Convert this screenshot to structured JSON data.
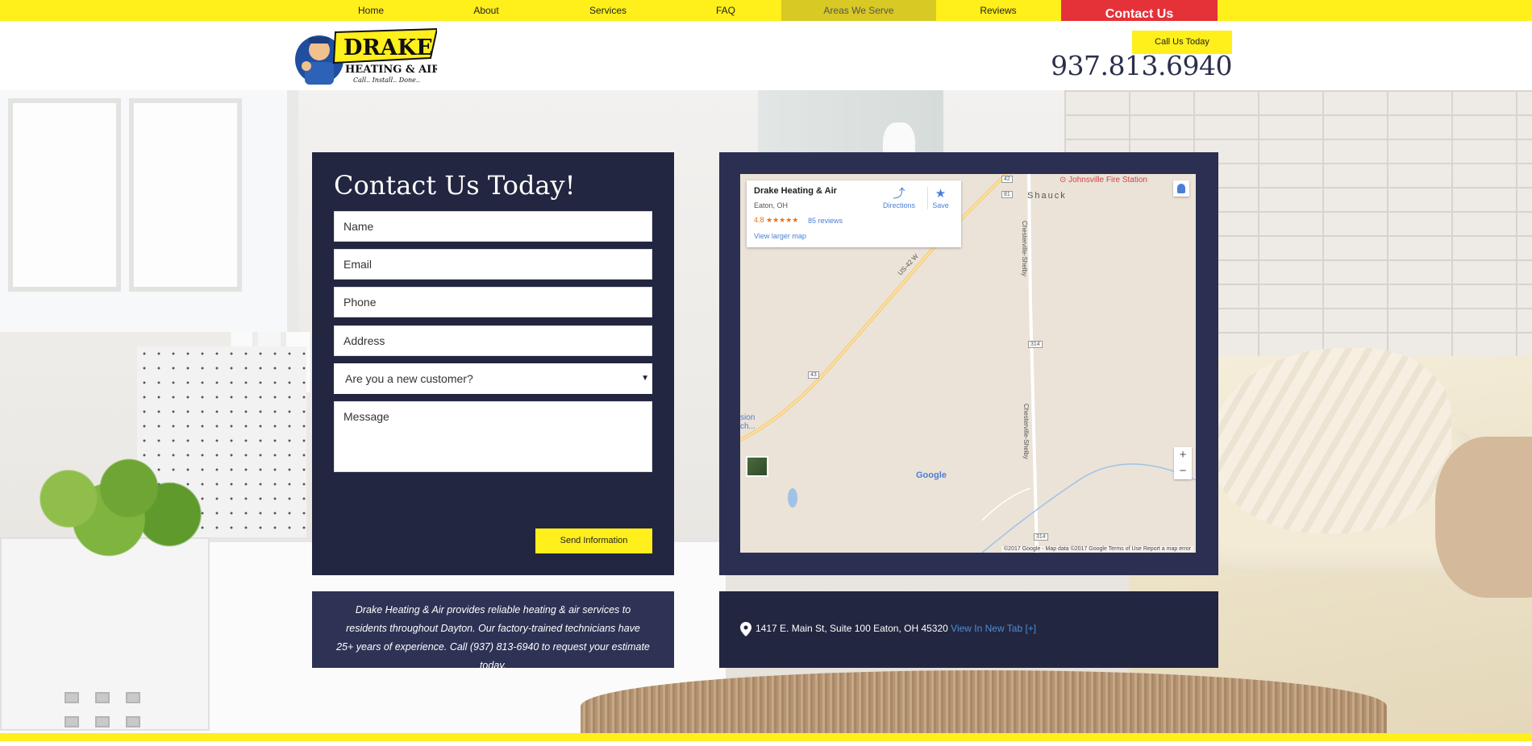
{
  "nav": {
    "items": [
      {
        "label": "Home",
        "active": false
      },
      {
        "label": "About",
        "active": false
      },
      {
        "label": "Services",
        "active": false
      },
      {
        "label": "FAQ",
        "active": false
      },
      {
        "label": "Areas We Serve",
        "active": true
      },
      {
        "label": "Reviews",
        "active": false
      }
    ],
    "contact_label": "Contact Us"
  },
  "header": {
    "logo_text": "DRAKE",
    "logo_sub": "HEATING & AIR",
    "logo_tagline": "Call.. Install.. Done..",
    "call_label": "Call Us Today",
    "phone": "937.813.6940"
  },
  "form": {
    "title": "Contact Us Today!",
    "name_placeholder": "Name",
    "email_placeholder": "Email",
    "phone_placeholder": "Phone",
    "address_placeholder": "Address",
    "customer_select": "Are you a new customer?",
    "message_placeholder": "Message",
    "submit_label": "Send Information"
  },
  "info": {
    "text": "Drake Heating & Air provides reliable heating & air services to residents throughout Dayton. Our factory-trained technicians have 25+ years of experience. Call (937) 813-6940 to request your estimate today."
  },
  "map": {
    "business_name": "Drake Heating & Air",
    "business_location": "Eaton, OH",
    "rating": "4.8 ★★★★★",
    "reviews_label": "85 reviews",
    "larger_map_label": "View larger map",
    "directions_label": "Directions",
    "save_label": "Save",
    "labels": {
      "fire_station": "Johnsville Fire Station",
      "shauck": "Shauck",
      "road_us42": "US-42 W",
      "road_chesterville": "Chesterville-Shelby",
      "road_chesterville2": "Chesterville-Shelby",
      "route_42": "42",
      "route_81": "81",
      "route_43": "43",
      "route_314a": "314",
      "route_314b": "314",
      "sion": "sion",
      "ch": "ch..."
    },
    "google_label": "Google",
    "attribution": "©2017 Google - Map data ©2017 Google   Terms of Use   Report a map error",
    "zoom_in": "+",
    "zoom_out": "−"
  },
  "address": {
    "text": "1417 E. Main St, Suite 100 Eaton, OH 45320",
    "link_label": "View In New Tab [+]"
  },
  "colors": {
    "yellow": "#ffef1a",
    "red": "#e53138",
    "navy": "#232640",
    "navy_light": "#2e3254",
    "link_blue": "#4a8fd6"
  }
}
